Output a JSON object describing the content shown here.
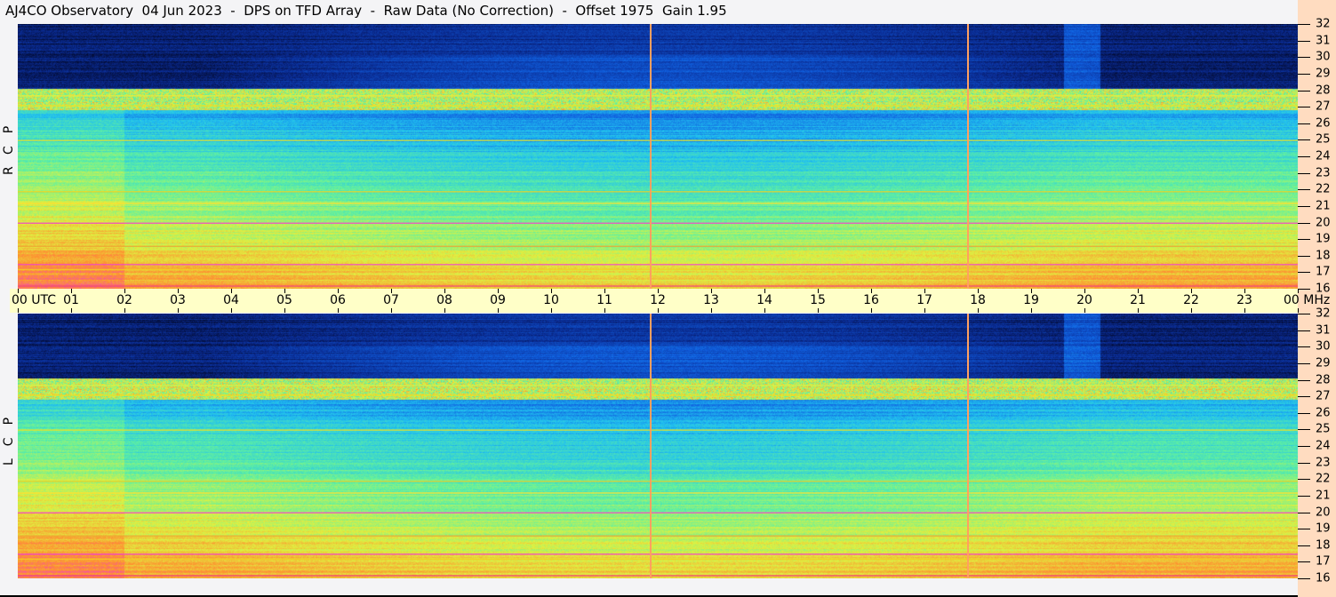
{
  "title": "AJ4CO Observatory  04 Jun 2023  -  DPS on TFD Array  -  Raw Data (No Correction)  -  Offset 1975  Gain 1.95",
  "chart_data": {
    "type": "heatmap",
    "title": "AJ4CO Observatory  04 Jun 2023  -  DPS on TFD Array  -  Raw Data (No Correction)  -  Offset 1975  Gain 1.95",
    "xlabel": "UTC",
    "ylabel": "MHz",
    "x_range_utc_hours": [
      0,
      24
    ],
    "y_range_mhz": [
      16,
      32
    ],
    "x_ticks": [
      "00 UTC",
      "01",
      "02",
      "03",
      "04",
      "05",
      "06",
      "07",
      "08",
      "09",
      "10",
      "11",
      "12",
      "13",
      "14",
      "15",
      "16",
      "17",
      "18",
      "19",
      "20",
      "21",
      "22",
      "23",
      "00 MHz"
    ],
    "y_ticks": [
      "32",
      "31",
      "30",
      "29",
      "28",
      "27",
      "26",
      "25",
      "24",
      "23",
      "22",
      "21",
      "20",
      "19",
      "18",
      "17",
      "16"
    ],
    "panels": [
      {
        "name": "RCP",
        "label": "RCP"
      },
      {
        "name": "LCP",
        "label": "LCP"
      }
    ],
    "vertical_markers_utc": [
      11.85,
      17.8
    ],
    "interference_lines_mhz": [
      {
        "f": 27.1,
        "color": "#f0e020"
      },
      {
        "f": 27.7,
        "color": "#e0f040"
      },
      {
        "f": 25.0,
        "color": "#f0e020"
      },
      {
        "f": 21.9,
        "color": "#f0d020"
      },
      {
        "f": 21.2,
        "color": "#ffe030"
      },
      {
        "f": 20.0,
        "color": "#f040d0"
      },
      {
        "f": 18.6,
        "color": "#f0a030"
      },
      {
        "f": 17.5,
        "color": "#f040d0"
      },
      {
        "f": 17.2,
        "color": "#f0d020"
      },
      {
        "f": 16.2,
        "color": "#f04080"
      }
    ],
    "colormap": [
      "#000010",
      "#0a2a90",
      "#1060e0",
      "#20c0f0",
      "#60f0a0",
      "#e0f040",
      "#ff9030",
      "#f030e0",
      "#ffffff"
    ]
  }
}
